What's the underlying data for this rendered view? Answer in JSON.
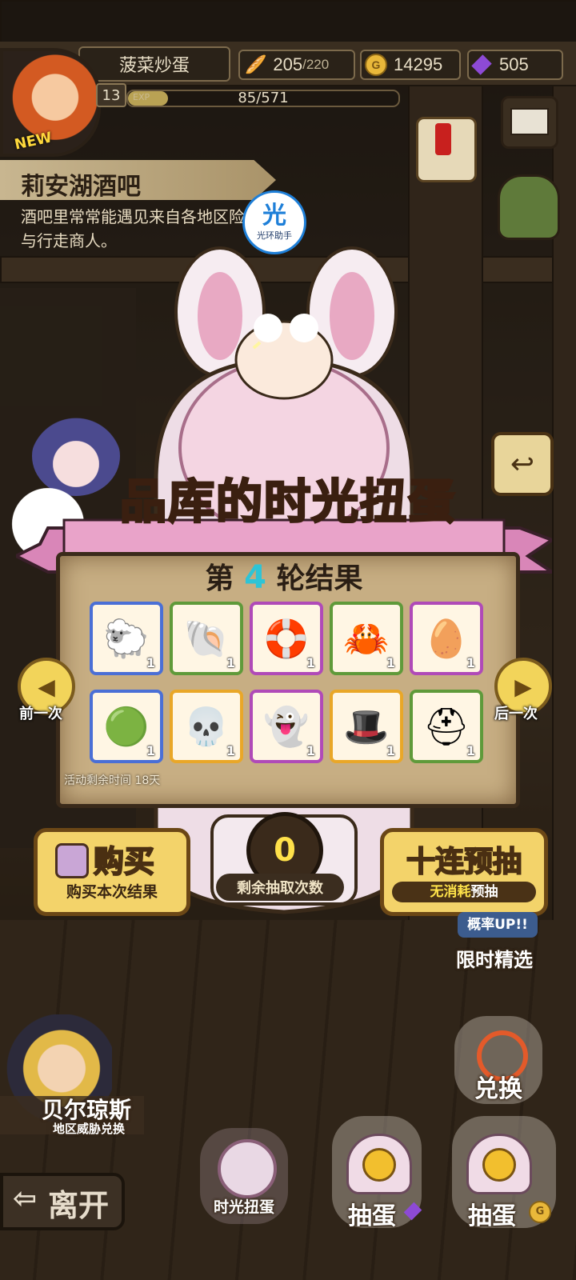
{
  "player": {
    "name": "菠菜炒蛋",
    "level": "13",
    "exp_label": "EXP",
    "exp_text": "85/571",
    "exp_fraction": 0.149,
    "new_tag": "NEW"
  },
  "resources": {
    "stamina": "205",
    "stamina_max": "/220",
    "gold": "14295",
    "gems": "505"
  },
  "location": {
    "title": "莉安湖酒吧",
    "description": "酒吧里常常能遇见来自各地区险者与行走商人。"
  },
  "badge": {
    "glyph": "光",
    "label": "光环助手"
  },
  "event": {
    "title_a": "品库的",
    "title_b": "时光",
    "title_c": "扭蛋",
    "round_prefix": "第",
    "round_num": "4",
    "round_suffix": "轮结果",
    "time_left": "活动剩余时间  18天"
  },
  "items": [
    {
      "name": "sheep",
      "qty": "1",
      "rarity": "blue"
    },
    {
      "name": "shell",
      "qty": "1",
      "rarity": "green"
    },
    {
      "name": "drill-lifebuoy",
      "qty": "1",
      "rarity": "purple"
    },
    {
      "name": "crab",
      "qty": "1",
      "rarity": "green"
    },
    {
      "name": "egg-leaves",
      "qty": "1",
      "rarity": "purple"
    },
    {
      "name": "green-slime-armor",
      "qty": "1",
      "rarity": "blue"
    },
    {
      "name": "skull-mask",
      "qty": "1",
      "rarity": "gold"
    },
    {
      "name": "white-ghost-bow",
      "qty": "1",
      "rarity": "purple"
    },
    {
      "name": "captain-helmet",
      "qty": "1",
      "rarity": "gold"
    },
    {
      "name": "iron-hat",
      "qty": "1",
      "rarity": "green"
    }
  ],
  "colors": {
    "blue": "#4a6fd6",
    "green": "#5f9a3a",
    "purple": "#b04ab8",
    "gold": "#e9a728"
  },
  "nav": {
    "prev": "前一次",
    "next": "后一次"
  },
  "actions": {
    "buy_title": "购买",
    "buy_sub": "购买本次结果",
    "ten_title": "十连预抽",
    "ten_sub_a": "无消耗",
    "ten_sub_b": "预抽",
    "draws_left": "0",
    "draws_label": "剩余抽取次数"
  },
  "side": {
    "limited_badge": "概率UP!!",
    "limited": "限时精选",
    "exchange": "兑换",
    "npc_name": "贝尔琼斯",
    "npc_sub": "地区威胁兑换"
  },
  "bottom": {
    "leave": "离开",
    "time_gacha": "时光扭蛋",
    "draw_gem": "抽蛋",
    "draw_gold": "抽蛋"
  }
}
